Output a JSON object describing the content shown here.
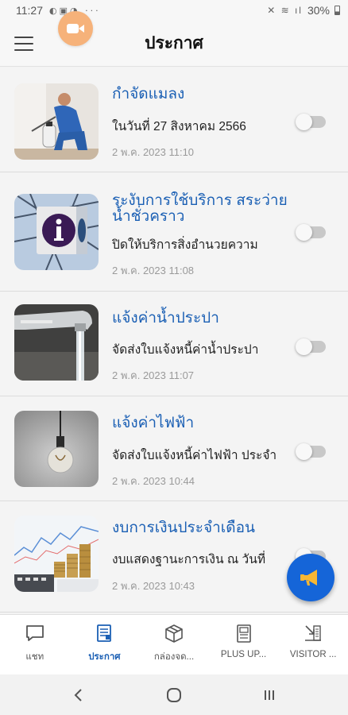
{
  "status_bar": {
    "time": "11:27",
    "battery": "30%"
  },
  "app_bar": {
    "title": "ประกาศ"
  },
  "announcements": [
    {
      "title": "กำจัดแมลง",
      "description": "ในวันที่ 27 สิงหาคม 2566",
      "date": "2 พ.ค. 2023 11:10",
      "enabled": false,
      "image": "pest-control-photo"
    },
    {
      "title": "ระงับการใช้บริการ สระว่ายน้ำชั่วคราว",
      "description": "ปิดให้บริการสิ่งอำนวยความ",
      "date": "2 พ.ค. 2023 11:08",
      "enabled": false,
      "image": "info-sign-photo"
    },
    {
      "title": "แจ้งค่าน้ำประปา",
      "description": "จัดส่งใบแจ้งหนี้ค่าน้ำประปา",
      "date": "2 พ.ค. 2023 11:07",
      "enabled": false,
      "image": "water-tap-photo"
    },
    {
      "title": "แจ้งค่าไฟฟ้า",
      "description": "จัดส่งใบแจ้งหนี้ค่าไฟฟ้า ประจำ",
      "date": "2 พ.ค. 2023 10:44",
      "enabled": false,
      "image": "light-bulb-photo"
    },
    {
      "title": "งบการเงินประจำเดือน",
      "description": "งบแสดงฐานะการเงิน ณ วันที่",
      "date": "2 พ.ค. 2023 10:43",
      "enabled": false,
      "image": "finance-chart-photo"
    }
  ],
  "bottom_nav": [
    {
      "label": "แชท",
      "icon": "chat-icon",
      "active": false
    },
    {
      "label": "ประกาศ",
      "icon": "document-icon",
      "active": true
    },
    {
      "label": "กล่องจด...",
      "icon": "parcel-icon",
      "active": false
    },
    {
      "label": "PLUS UP...",
      "icon": "clipboard-icon",
      "active": false
    },
    {
      "label": "VISITOR ...",
      "icon": "visitor-icon",
      "active": false
    }
  ],
  "colors": {
    "accent": "#1a5fb4",
    "fab": "#1565d8",
    "recording": "#f6b27a"
  }
}
